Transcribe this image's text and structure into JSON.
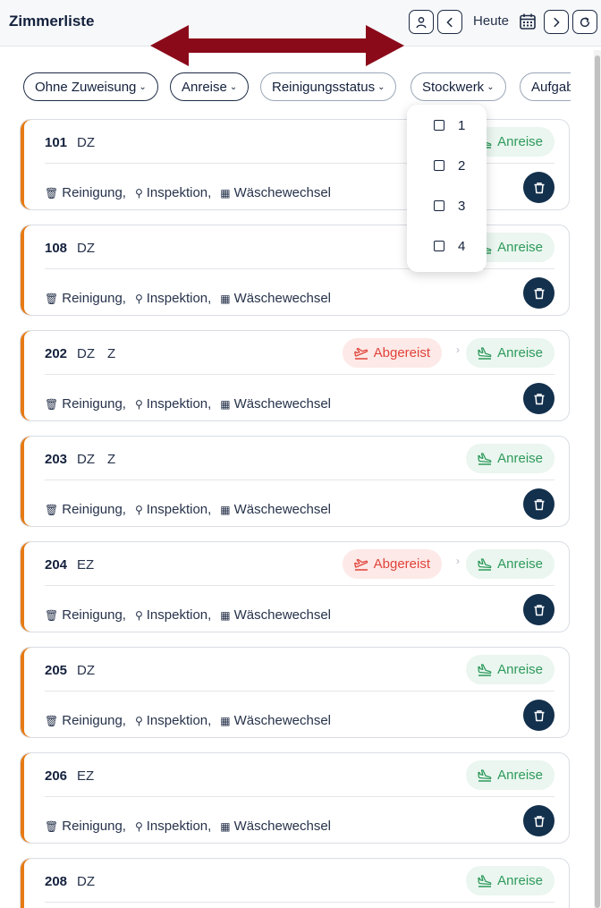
{
  "header": {
    "title": "Zimmerliste",
    "today_label": "Heute"
  },
  "colors": {
    "accent_orange": "#e67a14",
    "navy": "#13304c",
    "arrival_green": "#2e9a5c",
    "departed_red": "#e0433a",
    "annotation_arrow": "#8b0a1a"
  },
  "filters": [
    {
      "label": "Ohne Zuweisung"
    },
    {
      "label": "Anreise"
    },
    {
      "label": "Reinigungsstatus"
    },
    {
      "label": "Stockwerk"
    },
    {
      "label": "Aufgaben"
    }
  ],
  "floor_dropdown": {
    "options": [
      "1",
      "2",
      "3",
      "4"
    ]
  },
  "tasks": {
    "cleaning": "Reinigung,",
    "inspection": "Inspektion,",
    "linen": "Wäschewechsel"
  },
  "status": {
    "arrival": "Anreise",
    "departed": "Abgereist"
  },
  "rooms": [
    {
      "number": "101",
      "type": "DZ",
      "extra": ""
    },
    {
      "number": "108",
      "type": "DZ",
      "extra": ""
    },
    {
      "number": "202",
      "type": "DZ",
      "extra": "Z"
    },
    {
      "number": "203",
      "type": "DZ",
      "extra": "Z"
    },
    {
      "number": "204",
      "type": "EZ",
      "extra": ""
    },
    {
      "number": "205",
      "type": "DZ",
      "extra": ""
    },
    {
      "number": "206",
      "type": "EZ",
      "extra": ""
    },
    {
      "number": "208",
      "type": "DZ",
      "extra": ""
    }
  ]
}
